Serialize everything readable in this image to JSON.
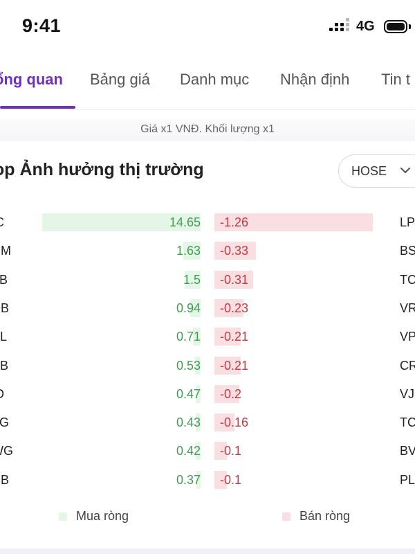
{
  "status_bar": {
    "time": "9:41",
    "network": "4G"
  },
  "tabs": [
    {
      "label": "ổng quan",
      "active": true
    },
    {
      "label": "Bảng giá",
      "active": false
    },
    {
      "label": "Danh mục",
      "active": false
    },
    {
      "label": "Nhận định",
      "active": false
    },
    {
      "label": "Tin t",
      "active": false
    }
  ],
  "note": "Giá x1 VNĐ. Khối lượng x1",
  "section": {
    "title": "op Ảnh hưởng thị trường",
    "exchange_select": {
      "value": "HOSE",
      "icon": "chevron-down-icon"
    }
  },
  "colors": {
    "accent": "#6f2fbf",
    "buy": "#3f9e53",
    "buy_bg": "#e4f6e6",
    "sell": "#c23b44",
    "sell_bg": "#f9dfe1"
  },
  "chart_data": {
    "type": "bar",
    "series": [
      {
        "name": "Mua ròng",
        "categories": [
          "IC",
          "HM",
          "TB",
          "DB",
          "PL",
          "BB",
          "ID",
          "TG",
          "WG",
          "CB"
        ],
        "values": [
          14.65,
          1.63,
          1.5,
          0.94,
          0.71,
          0.53,
          0.47,
          0.43,
          0.42,
          0.37
        ]
      },
      {
        "name": "Bán ròng",
        "categories": [
          "LP",
          "BS",
          "TC",
          "VR",
          "VP",
          "CR",
          "VJ",
          "TC",
          "BV",
          "PL"
        ],
        "values": [
          -1.26,
          -0.33,
          -0.31,
          -0.23,
          -0.21,
          -0.21,
          -0.2,
          -0.16,
          -0.1,
          -0.1
        ]
      }
    ]
  },
  "legend": [
    {
      "label": "Mua ròng",
      "color": "#e4f6e6"
    },
    {
      "label": "Bán ròng",
      "color": "#f9dfe1"
    }
  ]
}
